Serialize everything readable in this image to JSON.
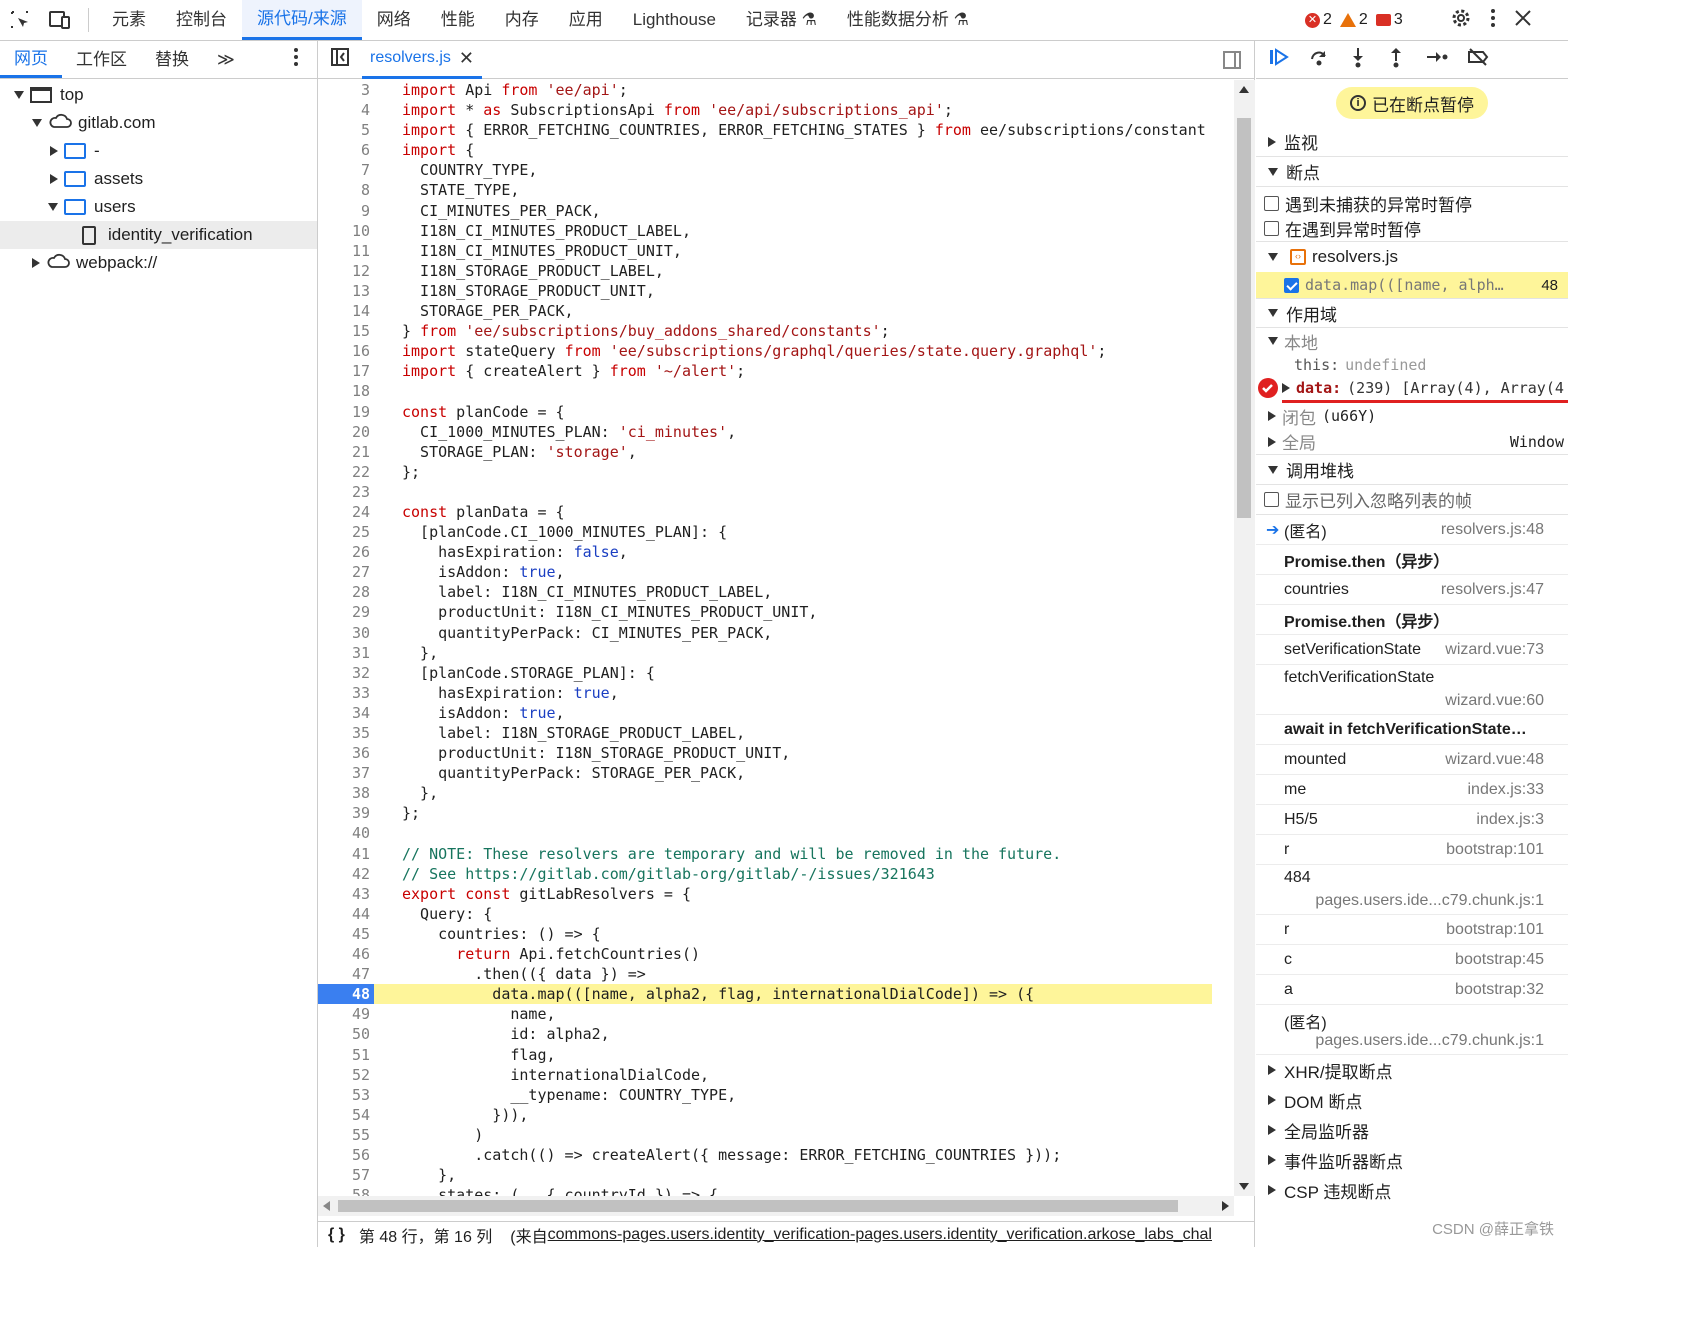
{
  "toolbar": {
    "tabs": [
      "元素",
      "控制台",
      "源代码/来源",
      "网络",
      "性能",
      "内存",
      "应用",
      "Lighthouse",
      "记录器 ⚗",
      "性能数据分析 ⚗"
    ],
    "active_tab": "源代码/来源",
    "errors": "2",
    "warnings": "2",
    "info": "3"
  },
  "navigator": {
    "tabs": [
      "网页",
      "工作区",
      "替换",
      "≫"
    ],
    "tree": [
      "top",
      "gitlab.com",
      "-",
      "assets",
      "users",
      "identity_verification",
      "webpack://"
    ]
  },
  "editor": {
    "file_tab": "resolvers.js",
    "status": "第 48 行，第 16 列",
    "source_prefix": "(来自 ",
    "source_link": "commons-pages.users.identity_verification-pages.users.identity_verification.arkose_labs_chal",
    "lines": [
      {
        "n": "3",
        "t": "import Api from 'ee/api';"
      },
      {
        "n": "4",
        "t": "import * as SubscriptionsApi from 'ee/api/subscriptions_api';"
      },
      {
        "n": "5",
        "t": "import { ERROR_FETCHING_COUNTRIES, ERROR_FETCHING_STATES } from 'ee/subscriptions/constant"
      },
      {
        "n": "6",
        "t": "import {"
      },
      {
        "n": "7",
        "t": "  COUNTRY_TYPE,"
      },
      {
        "n": "8",
        "t": "  STATE_TYPE,"
      },
      {
        "n": "9",
        "t": "  CI_MINUTES_PER_PACK,"
      },
      {
        "n": "10",
        "t": "  I18N_CI_MINUTES_PRODUCT_LABEL,"
      },
      {
        "n": "11",
        "t": "  I18N_CI_MINUTES_PRODUCT_UNIT,"
      },
      {
        "n": "12",
        "t": "  I18N_STORAGE_PRODUCT_LABEL,"
      },
      {
        "n": "13",
        "t": "  I18N_STORAGE_PRODUCT_UNIT,"
      },
      {
        "n": "14",
        "t": "  STORAGE_PER_PACK,"
      },
      {
        "n": "15",
        "t": "} from 'ee/subscriptions/buy_addons_shared/constants';"
      },
      {
        "n": "16",
        "t": "import stateQuery from 'ee/subscriptions/graphql/queries/state.query.graphql';"
      },
      {
        "n": "17",
        "t": "import { createAlert } from '~/alert';"
      },
      {
        "n": "18",
        "t": ""
      },
      {
        "n": "19",
        "t": "const planCode = {"
      },
      {
        "n": "20",
        "t": "  CI_1000_MINUTES_PLAN: 'ci_minutes',"
      },
      {
        "n": "21",
        "t": "  STORAGE_PLAN: 'storage',"
      },
      {
        "n": "22",
        "t": "};"
      },
      {
        "n": "23",
        "t": ""
      },
      {
        "n": "24",
        "t": "const planData = {"
      },
      {
        "n": "25",
        "t": "  [planCode.CI_1000_MINUTES_PLAN]: {"
      },
      {
        "n": "26",
        "t": "    hasExpiration: false,"
      },
      {
        "n": "27",
        "t": "    isAddon: true,"
      },
      {
        "n": "28",
        "t": "    label: I18N_CI_MINUTES_PRODUCT_LABEL,"
      },
      {
        "n": "29",
        "t": "    productUnit: I18N_CI_MINUTES_PRODUCT_UNIT,"
      },
      {
        "n": "30",
        "t": "    quantityPerPack: CI_MINUTES_PER_PACK,"
      },
      {
        "n": "31",
        "t": "  },"
      },
      {
        "n": "32",
        "t": "  [planCode.STORAGE_PLAN]: {"
      },
      {
        "n": "33",
        "t": "    hasExpiration: true,"
      },
      {
        "n": "34",
        "t": "    isAddon: true,"
      },
      {
        "n": "35",
        "t": "    label: I18N_STORAGE_PRODUCT_LABEL,"
      },
      {
        "n": "36",
        "t": "    productUnit: I18N_STORAGE_PRODUCT_UNIT,"
      },
      {
        "n": "37",
        "t": "    quantityPerPack: STORAGE_PER_PACK,"
      },
      {
        "n": "38",
        "t": "  },"
      },
      {
        "n": "39",
        "t": "};"
      },
      {
        "n": "40",
        "t": ""
      },
      {
        "n": "41",
        "t": "// NOTE: These resolvers are temporary and will be removed in the future."
      },
      {
        "n": "42",
        "t": "// See https://gitlab.com/gitlab-org/gitlab/-/issues/321643"
      },
      {
        "n": "43",
        "t": "export const gitLabResolvers = {"
      },
      {
        "n": "44",
        "t": "  Query: {"
      },
      {
        "n": "45",
        "t": "    countries: () => {"
      },
      {
        "n": "46",
        "t": "      return Api.fetchCountries()"
      },
      {
        "n": "47",
        "t": "        .then(({ data }) =>"
      },
      {
        "n": "48",
        "t": "          data.map(([name, alpha2, flag, internationalDialCode]) => ({"
      },
      {
        "n": "49",
        "t": "            name,"
      },
      {
        "n": "50",
        "t": "            id: alpha2,"
      },
      {
        "n": "51",
        "t": "            flag,"
      },
      {
        "n": "52",
        "t": "            internationalDialCode,"
      },
      {
        "n": "53",
        "t": "            __typename: COUNTRY_TYPE,"
      },
      {
        "n": "54",
        "t": "          })),"
      },
      {
        "n": "55",
        "t": "        )"
      },
      {
        "n": "56",
        "t": "        .catch(() => createAlert({ message: ERROR_FETCHING_COUNTRIES }));"
      },
      {
        "n": "57",
        "t": "    },"
      },
      {
        "n": "58",
        "t": "    states: (_, { countryId }) => {"
      }
    ]
  },
  "debugger": {
    "paused_label": "已在断点暂停",
    "watch": "监视",
    "breakpoints": "断点",
    "pause_uncaught": "遇到未捕获的异常时暂停",
    "pause_caught": "在遇到异常时暂停",
    "bp_file": "resolvers.js",
    "bp_code": "data.map(([name, alph…",
    "bp_line": "48",
    "scope": "作用域",
    "local": "本地",
    "this_key": "this:",
    "this_val": "undefined",
    "data_key": "data:",
    "data_val": "(239) [Array(4), Array(4",
    "closure": "闭包",
    "closure_val": "(u66Y)",
    "global": "全局",
    "global_val": "Window",
    "callstack": "调用堆栈",
    "show_ignored": "显示已列入忽略列表的帧",
    "frames": [
      {
        "name": "(匿名)",
        "loc": "resolvers.js:48",
        "bold": false
      },
      {
        "name": "Promise.then（异步）",
        "loc": "",
        "bold": true
      },
      {
        "name": "countries",
        "loc": "resolvers.js:47",
        "bold": false
      },
      {
        "name": "Promise.then（异步）",
        "loc": "",
        "bold": true
      },
      {
        "name": "setVerificationState",
        "loc": "wizard.vue:73",
        "bold": false
      },
      {
        "name": "fetchVerificationState",
        "loc": "wizard.vue:60",
        "bold": false,
        "two": true
      },
      {
        "name": "await in fetchVerificationState…",
        "loc": "",
        "bold": true
      },
      {
        "name": "mounted",
        "loc": "wizard.vue:48",
        "bold": false
      },
      {
        "name": "me",
        "loc": "index.js:33",
        "bold": false
      },
      {
        "name": "H5/5",
        "loc": "index.js:3",
        "bold": false
      },
      {
        "name": "r",
        "loc": "bootstrap:101",
        "bold": false
      },
      {
        "name": "484",
        "loc": "pages.users.ide...c79.chunk.js:1",
        "bold": false,
        "two": true
      },
      {
        "name": "r",
        "loc": "bootstrap:101",
        "bold": false
      },
      {
        "name": "c",
        "loc": "bootstrap:45",
        "bold": false
      },
      {
        "name": "a",
        "loc": "bootstrap:32",
        "bold": false
      },
      {
        "name": "(匿名)",
        "loc": "pages.users.ide...c79.chunk.js:1",
        "bold": false,
        "two": true
      }
    ],
    "sections": [
      "XHR/提取断点",
      "DOM 断点",
      "全局监听器",
      "事件监听器断点",
      "CSP 违规断点"
    ],
    "watermark": "CSDN @薛正拿铁"
  }
}
